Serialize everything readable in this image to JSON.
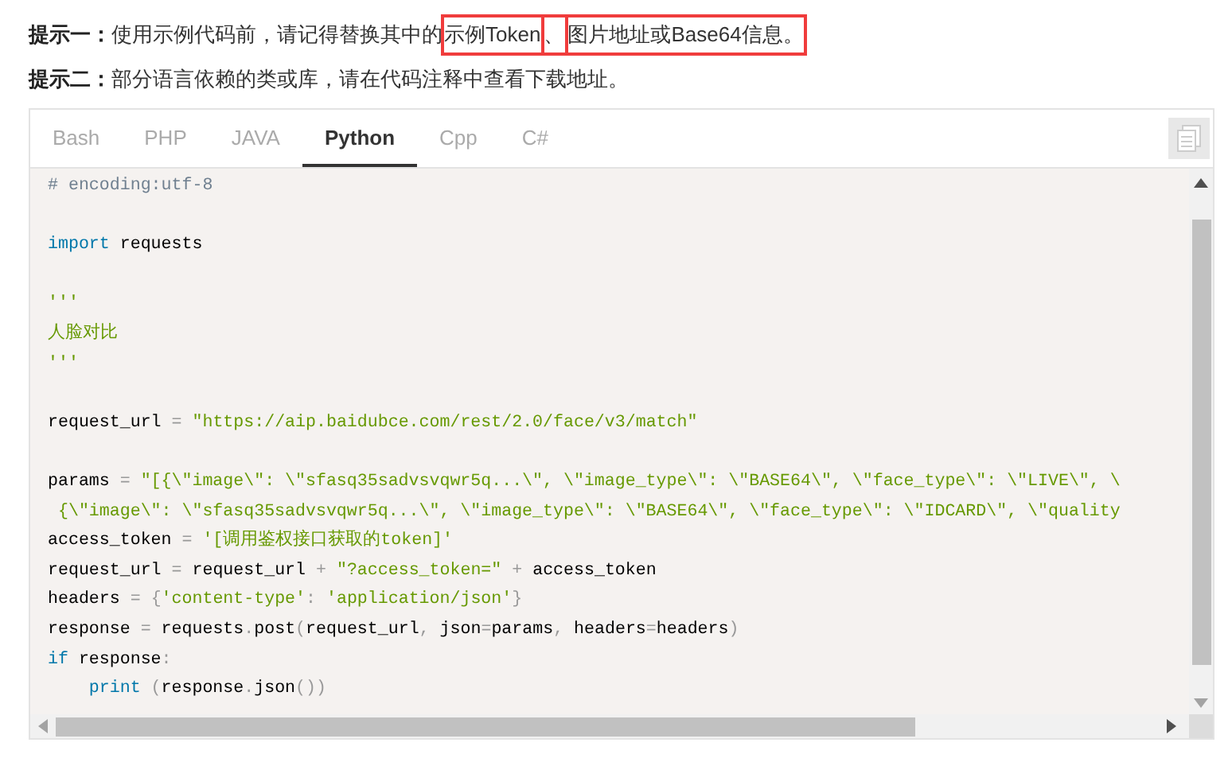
{
  "hints": [
    {
      "segments": [
        {
          "text": "**提示一：**使用示例代码前，请记得替换其中的",
          "highlighted": false
        },
        {
          "text": "示例Token",
          "highlighted": true
        },
        {
          "text": "、",
          "highlighted": true
        },
        {
          "text": "图片地址或Base64信息。",
          "highlighted": true
        }
      ]
    },
    {
      "segments": [
        {
          "text": "**提示二：**部分语言依赖的类或库，请在代码注释中查看下载地址。",
          "highlighted": false
        }
      ]
    }
  ],
  "tabs": [
    {
      "label": "Bash",
      "selected": false
    },
    {
      "label": "PHP",
      "selected": false
    },
    {
      "label": "JAVA",
      "selected": false
    },
    {
      "label": "Python",
      "selected": true
    },
    {
      "label": "Cpp",
      "selected": false
    },
    {
      "label": "C#",
      "selected": false
    }
  ],
  "code_lines": [
    {
      "kind": "code",
      "segments": [
        {
          "kind": "comment",
          "text": "# encoding:utf-8"
        }
      ]
    },
    {
      "kind": "blank"
    },
    {
      "kind": "code",
      "segments": [
        {
          "kind": "keyword",
          "text": "import"
        },
        {
          "kind": "plain",
          "text": " requests"
        }
      ]
    },
    {
      "kind": "blank"
    },
    {
      "kind": "code",
      "segments": [
        {
          "kind": "string",
          "text": "'''"
        }
      ]
    },
    {
      "kind": "code",
      "segments": [
        {
          "kind": "string",
          "text": "人脸对比"
        }
      ]
    },
    {
      "kind": "code",
      "segments": [
        {
          "kind": "string",
          "text": "'''"
        }
      ]
    },
    {
      "kind": "blank"
    },
    {
      "kind": "code",
      "segments": [
        {
          "kind": "plain",
          "text": "request_url "
        },
        {
          "kind": "op",
          "text": "= "
        },
        {
          "kind": "string",
          "text": "\"https://aip.baidubce.com/rest/2.0/face/v3/match\""
        }
      ]
    },
    {
      "kind": "blank"
    },
    {
      "kind": "code",
      "segments": [
        {
          "kind": "plain",
          "text": "params "
        },
        {
          "kind": "op",
          "text": "= "
        },
        {
          "kind": "string",
          "text": "\"[{\\\"image\\\": \\\"sfasq35sadvsvqwr5q...\\\", \\\"image_type\\\": \\\"BASE64\\\", \\\"face_type\\\": \\\"LIVE\\\", \\"
        }
      ]
    },
    {
      "kind": "code",
      "segments": [
        {
          "kind": "string",
          "text": " {\\\"image\\\": \\\"sfasq35sadvsvqwr5q...\\\", \\\"image_type\\\": \\\"BASE64\\\", \\\"face_type\\\": \\\"IDCARD\\\", \\\"quality"
        }
      ]
    },
    {
      "kind": "code",
      "segments": [
        {
          "kind": "plain",
          "text": "access_token "
        },
        {
          "kind": "op",
          "text": "= "
        },
        {
          "kind": "string",
          "text": "'[调用鉴权接口获取的token]'"
        }
      ]
    },
    {
      "kind": "code",
      "segments": [
        {
          "kind": "plain",
          "text": "request_url "
        },
        {
          "kind": "op",
          "text": "= "
        },
        {
          "kind": "plain",
          "text": "request_url "
        },
        {
          "kind": "op",
          "text": "+ "
        },
        {
          "kind": "string",
          "text": "\"?access_token=\" "
        },
        {
          "kind": "op",
          "text": "+ "
        },
        {
          "kind": "plain",
          "text": "access_token"
        }
      ]
    },
    {
      "kind": "code",
      "segments": [
        {
          "kind": "plain",
          "text": "headers "
        },
        {
          "kind": "op",
          "text": "= "
        },
        {
          "kind": "punct",
          "text": "{"
        },
        {
          "kind": "string",
          "text": "'content-type'"
        },
        {
          "kind": "punct",
          "text": ": "
        },
        {
          "kind": "string",
          "text": "'application/json'"
        },
        {
          "kind": "punct",
          "text": "}"
        }
      ]
    },
    {
      "kind": "code",
      "segments": [
        {
          "kind": "plain",
          "text": "response "
        },
        {
          "kind": "op",
          "text": "= "
        },
        {
          "kind": "plain",
          "text": "requests"
        },
        {
          "kind": "punct",
          "text": "."
        },
        {
          "kind": "plain",
          "text": "post"
        },
        {
          "kind": "punct",
          "text": "("
        },
        {
          "kind": "plain",
          "text": "request_url"
        },
        {
          "kind": "punct",
          "text": ", "
        },
        {
          "kind": "plain",
          "text": "json"
        },
        {
          "kind": "op",
          "text": "="
        },
        {
          "kind": "plain",
          "text": "params"
        },
        {
          "kind": "punct",
          "text": ", "
        },
        {
          "kind": "plain",
          "text": "headers"
        },
        {
          "kind": "op",
          "text": "="
        },
        {
          "kind": "plain",
          "text": "headers"
        },
        {
          "kind": "punct",
          "text": ")"
        }
      ]
    },
    {
      "kind": "code",
      "segments": [
        {
          "kind": "keyword",
          "text": "if"
        },
        {
          "kind": "plain",
          "text": " response"
        },
        {
          "kind": "punct",
          "text": ":"
        }
      ]
    },
    {
      "kind": "code",
      "segments": [
        {
          "kind": "keyword",
          "text": "    print "
        },
        {
          "kind": "punct",
          "text": "("
        },
        {
          "kind": "plain",
          "text": "response"
        },
        {
          "kind": "punct",
          "text": "."
        },
        {
          "kind": "plain",
          "text": "json"
        },
        {
          "kind": "punct",
          "text": "())"
        }
      ]
    }
  ]
}
